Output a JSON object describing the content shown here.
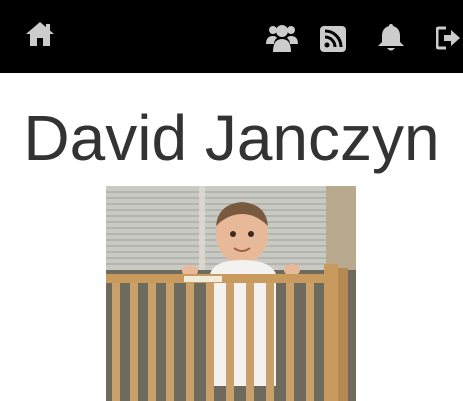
{
  "nav": {
    "icons": [
      "home-icon",
      "users-icon",
      "rss-icon",
      "bell-icon",
      "sign-out-icon"
    ],
    "icon_color": "#cccccc",
    "background": "#000000"
  },
  "profile": {
    "name": "David Janczyn",
    "name_color": "#333333"
  }
}
